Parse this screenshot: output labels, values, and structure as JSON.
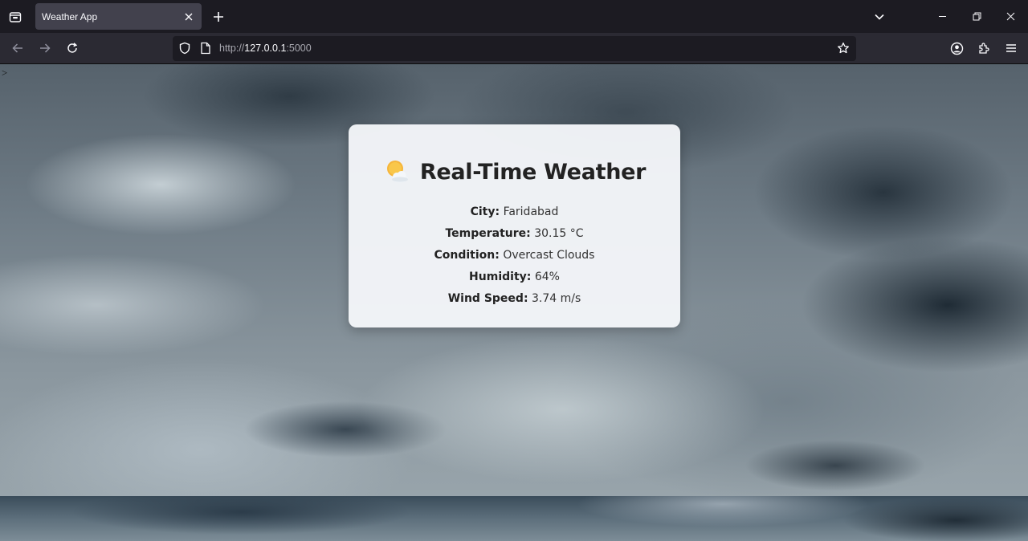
{
  "browser": {
    "tab": {
      "title": "Weather App"
    },
    "url": {
      "prefix": "http://",
      "host": "127.0.0.1",
      "suffix": ":5000"
    }
  },
  "page": {
    "prompt_char": ">",
    "card": {
      "title": "Real-Time Weather",
      "rows": [
        {
          "label": "City:",
          "value": "Faridabad"
        },
        {
          "label": "Temperature:",
          "value": "30.15 °C"
        },
        {
          "label": "Condition:",
          "value": "Overcast Clouds"
        },
        {
          "label": "Humidity:",
          "value": "64%"
        },
        {
          "label": "Wind Speed:",
          "value": "3.74 m/s"
        }
      ]
    }
  }
}
